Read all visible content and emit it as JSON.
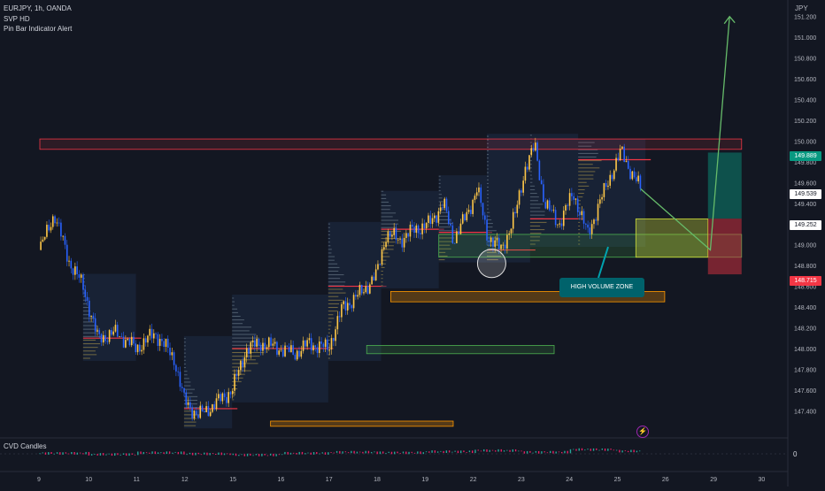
{
  "header": {
    "symbol": "EURJPY, 1h, OANDA",
    "indicator_1": "SVP HD",
    "indicator_2": "Pin Bar Indicator Alert"
  },
  "subpanel": {
    "title": "CVD Candles",
    "zero_label": "0"
  },
  "currency_label": "JPY",
  "price_tags": {
    "current_high": "149.889",
    "current": "149.539",
    "level": "149.252",
    "low": "148.715"
  },
  "annotation": {
    "text": "HIGH VOLUME ZONE"
  },
  "colors": {
    "background": "#131722",
    "bull": "#ffc849",
    "bear": "#2962ff",
    "poc": "#f23645",
    "green_tag": "#089981",
    "red_tag": "#f23645",
    "arrow": "#66bb6a",
    "callout": "#00626b"
  },
  "chart_data": {
    "type": "candlestick",
    "symbol": "EURJPY",
    "timeframe": "1h",
    "y_axis": {
      "ticks": [
        "151.200",
        "151.000",
        "150.800",
        "150.600",
        "150.400",
        "150.200",
        "150.000",
        "149.800",
        "149.600",
        "149.400",
        "149.200",
        "149.000",
        "148.800",
        "148.600",
        "148.400",
        "148.200",
        "148.000",
        "147.800",
        "147.600",
        "147.400"
      ],
      "range": [
        147.3,
        151.3
      ]
    },
    "x_axis": {
      "ticks": [
        "9",
        "10",
        "11",
        "12",
        "15",
        "16",
        "17",
        "18",
        "19",
        "22",
        "23",
        "24",
        "25",
        "26",
        "29",
        "30"
      ]
    },
    "price_path": [
      {
        "d": 0,
        "p": 148.95
      },
      {
        "d": 0.3,
        "p": 149.3
      },
      {
        "d": 0.6,
        "p": 148.85
      },
      {
        "d": 0.9,
        "p": 148.6
      },
      {
        "d": 1.2,
        "p": 148.1
      },
      {
        "d": 1.6,
        "p": 148.15
      },
      {
        "d": 2.0,
        "p": 148.0
      },
      {
        "d": 2.4,
        "p": 148.15
      },
      {
        "d": 2.8,
        "p": 147.9
      },
      {
        "d": 3.0,
        "p": 147.5
      },
      {
        "d": 3.3,
        "p": 147.35
      },
      {
        "d": 3.6,
        "p": 147.45
      },
      {
        "d": 4.0,
        "p": 147.6
      },
      {
        "d": 4.3,
        "p": 148.0
      },
      {
        "d": 4.6,
        "p": 148.05
      },
      {
        "d": 5.0,
        "p": 148.0
      },
      {
        "d": 5.3,
        "p": 147.95
      },
      {
        "d": 5.6,
        "p": 148.05
      },
      {
        "d": 6.0,
        "p": 148.0
      },
      {
        "d": 6.3,
        "p": 148.4
      },
      {
        "d": 6.6,
        "p": 148.5
      },
      {
        "d": 7.0,
        "p": 148.7
      },
      {
        "d": 7.2,
        "p": 149.1
      },
      {
        "d": 7.5,
        "p": 149.05
      },
      {
        "d": 7.8,
        "p": 149.15
      },
      {
        "d": 8.1,
        "p": 149.2
      },
      {
        "d": 8.4,
        "p": 149.4
      },
      {
        "d": 8.6,
        "p": 149.05
      },
      {
        "d": 8.9,
        "p": 149.3
      },
      {
        "d": 9.1,
        "p": 149.55
      },
      {
        "d": 9.3,
        "p": 149.1
      },
      {
        "d": 9.6,
        "p": 148.95
      },
      {
        "d": 9.9,
        "p": 149.3
      },
      {
        "d": 10.1,
        "p": 149.75
      },
      {
        "d": 10.3,
        "p": 149.95
      },
      {
        "d": 10.5,
        "p": 149.4
      },
      {
        "d": 10.8,
        "p": 149.2
      },
      {
        "d": 11.1,
        "p": 149.5
      },
      {
        "d": 11.4,
        "p": 149.1
      },
      {
        "d": 11.6,
        "p": 149.35
      },
      {
        "d": 11.9,
        "p": 149.7
      },
      {
        "d": 12.1,
        "p": 149.9
      },
      {
        "d": 12.3,
        "p": 149.7
      },
      {
        "d": 12.5,
        "p": 149.539
      }
    ],
    "volume_profile_sessions": [
      {
        "from": 0.9,
        "to": 2.0,
        "poc": 148.1
      },
      {
        "from": 3.0,
        "to": 4.0,
        "poc": 147.42
      },
      {
        "from": 4.0,
        "to": 6.0,
        "poc": 148.0
      },
      {
        "from": 6.0,
        "to": 7.1,
        "poc": 148.6
      },
      {
        "from": 7.1,
        "to": 8.3,
        "poc": 149.15
      },
      {
        "from": 8.3,
        "to": 9.3,
        "poc": 149.12
      },
      {
        "from": 9.3,
        "to": 10.2,
        "poc": 148.95
      },
      {
        "from": 10.2,
        "to": 11.2,
        "poc": 149.25
      },
      {
        "from": 11.2,
        "to": 12.6,
        "poc": 149.82
      }
    ],
    "zones": [
      {
        "name": "resistance",
        "from": 0,
        "to": 14.6,
        "low": 149.92,
        "high": 150.02,
        "color": "#f23645"
      },
      {
        "name": "supply-orange",
        "from": 7.3,
        "to": 13.0,
        "low": 148.45,
        "high": 148.55,
        "color": "#ff9800"
      },
      {
        "name": "demand-green",
        "from": 6.8,
        "to": 10.7,
        "low": 147.95,
        "high": 148.03,
        "color": "#4caf50"
      },
      {
        "name": "high-volume-zone",
        "from": 8.3,
        "to": 14.6,
        "low": 148.88,
        "high": 149.1,
        "color": "#4caf50"
      },
      {
        "name": "yellow-zone",
        "from": 12.4,
        "to": 13.9,
        "low": 148.88,
        "high": 149.25,
        "color": "#cddc39"
      },
      {
        "name": "bottom-orange",
        "from": 4.8,
        "to": 8.6,
        "low": 147.25,
        "high": 147.3,
        "color": "#ff9800"
      }
    ],
    "position": {
      "entry": 149.252,
      "target": 149.889,
      "stop": 148.715,
      "from": 13.9,
      "to": 14.6
    },
    "projection": [
      {
        "d": 12.5,
        "p": 149.539
      },
      {
        "d": 13.95,
        "p": 148.95
      },
      {
        "d": 14.35,
        "p": 151.2
      }
    ],
    "marked_low": {
      "d": 9.4,
      "p": 148.82
    },
    "cvd_values": [
      0.1,
      -0.1,
      0.2,
      0.0,
      -0.2,
      0.1,
      0.3,
      0.2,
      0.4,
      0.6,
      0.3,
      0.8,
      0.5,
      0.4,
      0.6
    ]
  }
}
